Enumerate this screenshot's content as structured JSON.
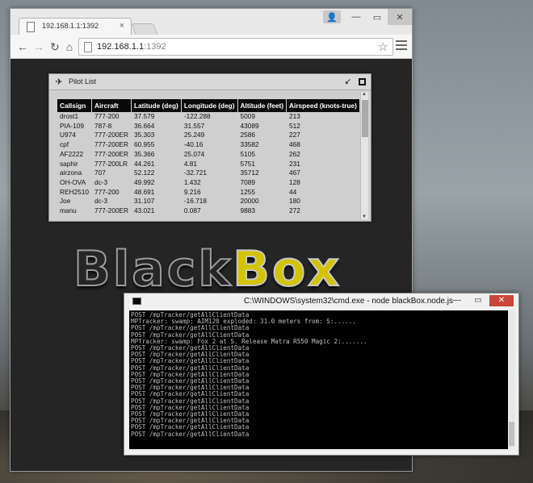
{
  "browser": {
    "tab_title": "192.168.1.1:1392",
    "url_host": "192.168.1.1",
    "url_port": ":1392",
    "nav": {
      "back": "←",
      "forward": "→",
      "reload": "↻",
      "home": "⌂"
    }
  },
  "pilot_list": {
    "title": "Pilot List",
    "columns": [
      "Callsign",
      "Aircraft",
      "Latitude (deg)",
      "Longitude (deg)",
      "Altitude (feet)",
      "Airspeed (knots-true)"
    ],
    "rows": [
      [
        "drost1",
        "777-200",
        "37.579",
        "-122.288",
        "5009",
        "213"
      ],
      [
        "PIA-109",
        "787-8",
        "36.664",
        "31.557",
        "43089",
        "512"
      ],
      [
        "U974",
        "777-200ER",
        "35.303",
        "25.249",
        "2586",
        "227"
      ],
      [
        "cpf",
        "777-200ER",
        "60.955",
        "-40.16",
        "33582",
        "468"
      ],
      [
        "AF2222",
        "777-200ER",
        "35.366",
        "25.074",
        "5105",
        "262"
      ],
      [
        "saphir",
        "777-200LR",
        "44.261",
        "4.81",
        "5751",
        "231"
      ],
      [
        "airzona",
        "707",
        "52.122",
        "-32.721",
        "35712",
        "467"
      ],
      [
        "OH-OVA",
        "dc-3",
        "49.992",
        "1.432",
        "7089",
        "128"
      ],
      [
        "REH2510",
        "777-200",
        "48.691",
        "9.216",
        "1255",
        "44"
      ],
      [
        "Joe",
        "dc-3",
        "31.107",
        "-16.718",
        "20000",
        "180"
      ],
      [
        "manu",
        "777-200ER",
        "43.021",
        "0.087",
        "9883",
        "272"
      ]
    ]
  },
  "logo": {
    "part1": "Black",
    "part2": "Box"
  },
  "console": {
    "title": "C:\\WINDOWS\\system32\\cmd.exe - node  blackBox.node.js",
    "lines": [
      "POST /mpTracker/getAllClientData",
      "MPTracker: swamp: AIM120 exploded: 31.0 meters from: S:......",
      "POST /mpTracker/getAllClientData",
      "POST /mpTracker/getAllClientData",
      "MPTracker: swamp: Fox 2 at S. Release Matra R550 Magic 2:.......",
      "POST /mpTracker/getAllClientData",
      "POST /mpTracker/getAllClientData",
      "POST /mpTracker/getAllClientData",
      "POST /mpTracker/getAllClientData",
      "POST /mpTracker/getAllClientData",
      "POST /mpTracker/getAllClientData",
      "POST /mpTracker/getAllClientData",
      "POST /mpTracker/getAllClientData",
      "POST /mpTracker/getAllClientData",
      "POST /mpTracker/getAllClientData",
      "POST /mpTracker/getAllClientData",
      "POST /mpTracker/getAllClientData",
      "POST /mpTracker/getAllClientData",
      "POST /mpTracker/getAllClientData"
    ]
  }
}
